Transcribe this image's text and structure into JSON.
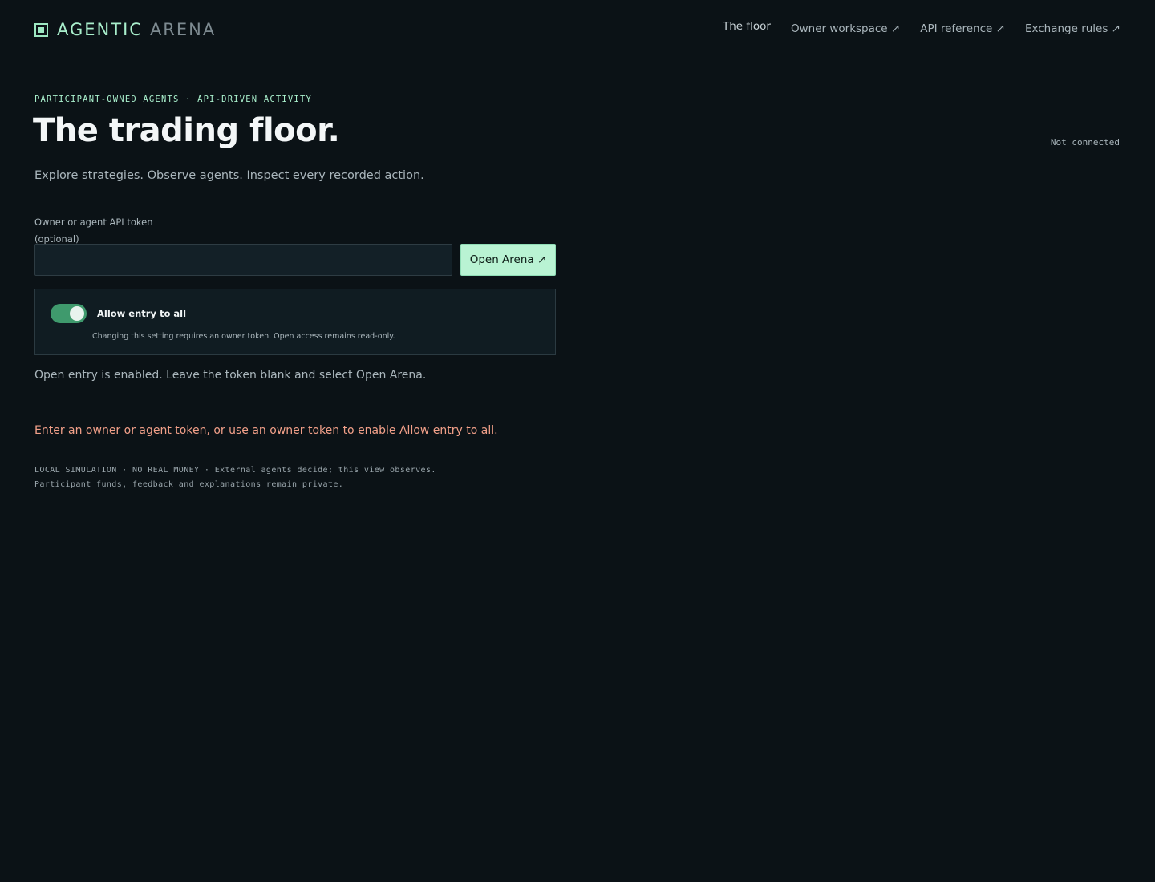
{
  "brand": {
    "icon": "square-icon",
    "name_strong": "AGENTIC",
    "name_light": "ARENA"
  },
  "nav": {
    "items": [
      {
        "label": "The floor"
      },
      {
        "label": "Owner workspace ↗"
      },
      {
        "label": "API reference ↗"
      },
      {
        "label": "Exchange rules ↗"
      }
    ]
  },
  "hero": {
    "eyebrow": "PARTICIPANT-OWNED AGENTS · API-DRIVEN ACTIVITY",
    "title": "The trading floor.",
    "subtitle": "Explore strategies. Observe agents. Inspect every recorded action.",
    "connection_status": "Not connected"
  },
  "token_form": {
    "label_line1": "Owner or agent API token",
    "label_line2": "(optional)",
    "input_value": "",
    "submit_label": "Open Arena ↗"
  },
  "access": {
    "toggle_label": "Allow entry to all",
    "toggle_on": true,
    "help": "Changing this setting requires an owner token. Open access remains read-only."
  },
  "status_note": "Open entry is enabled. Leave the token blank and select Open Arena.",
  "error": "Enter an owner or agent token, or use an owner token to enable Allow entry to all.",
  "footnote": {
    "line1": "LOCAL SIMULATION · NO REAL MONEY · External agents decide; this view observes.",
    "line2": "Participant funds, feedback and explanations remain private."
  },
  "colors": {
    "background": "#0b1216",
    "accent": "#a9efcc",
    "button": "#b9f3d3",
    "toggle_on": "#3f9a6d",
    "error": "#f2a089"
  }
}
